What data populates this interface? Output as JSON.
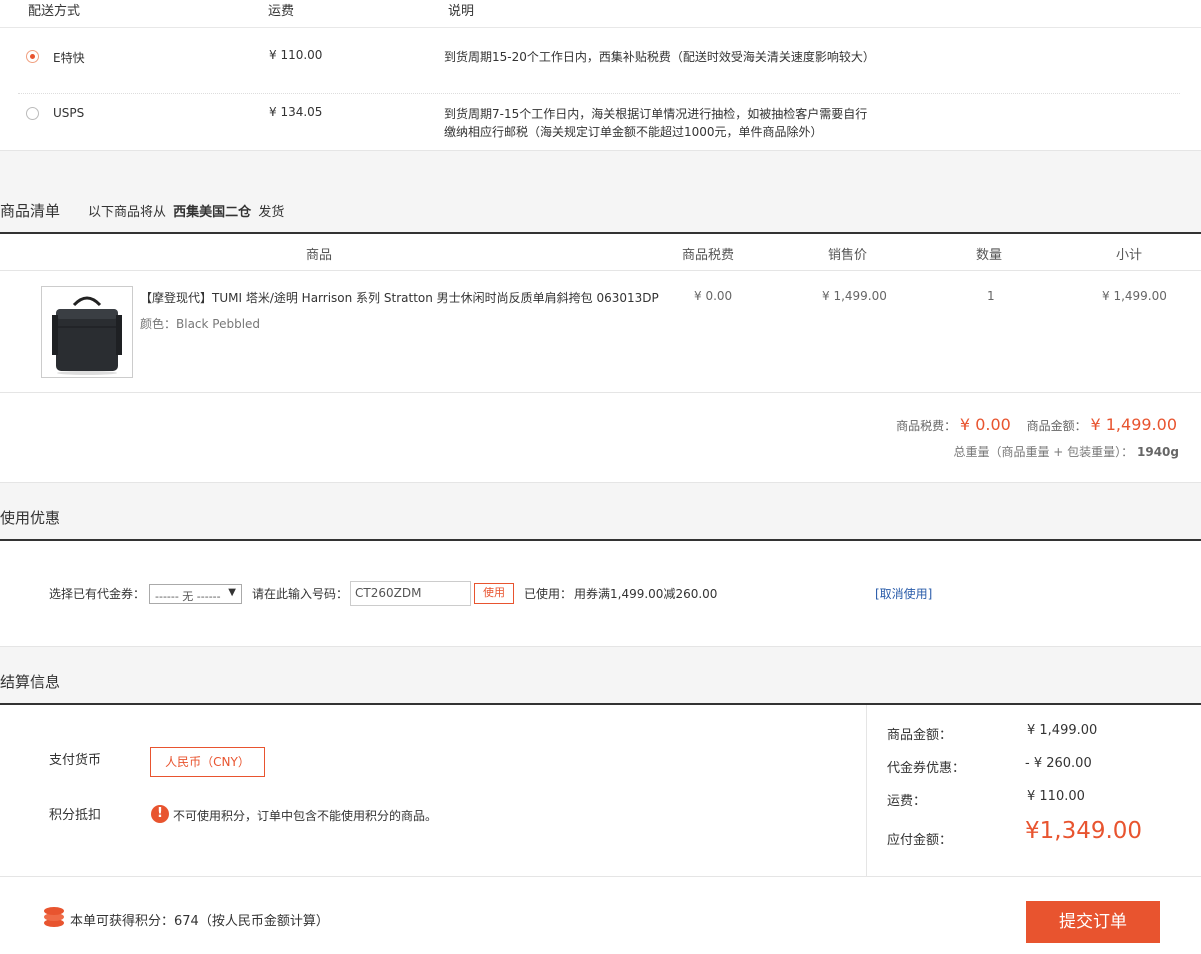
{
  "shipping": {
    "headers": [
      "配送方式",
      "运费",
      "说明"
    ],
    "options": [
      {
        "name": "E特快",
        "fee": "¥ 110.00",
        "desc": [
          "到货周期15-20个工作日内，西集补贴税费（配送时效受海关清关速度影响较大）"
        ],
        "selected": true
      },
      {
        "name": "USPS",
        "fee": "¥ 134.05",
        "desc": [
          "到货周期7-15个工作日内，海关根据订单情况进行抽检，如被抽检客户需要自行",
          "缴纳相应行邮税（海关规定订单金额不能超过1000元，单件商品除外）"
        ],
        "selected": false
      }
    ]
  },
  "goods": {
    "title": "商品清单",
    "ship_from_prefix": "以下商品将从",
    "warehouse": "西集美国二仓",
    "ship_from_suffix": "发货",
    "columns": [
      "商品",
      "商品税费",
      "销售价",
      "数量",
      "小计"
    ],
    "items": [
      {
        "name": "【摩登现代】TUMI 塔米/途明 Harrison 系列 Stratton 男士休闲时尚反质单肩斜挎包 063013DP",
        "color": "颜色：Black Pebbled",
        "tax": "¥ 0.00",
        "price": "¥ 1,499.00",
        "qty": "1",
        "subtotal": "¥ 1,499.00"
      }
    ],
    "summary": {
      "tax_label": "商品税费：",
      "tax_value": "¥ 0.00",
      "amount_label": "商品金额：",
      "amount_value": "¥ 1,499.00",
      "weight_label": "总重量（商品重量 + 包装重量）：",
      "weight_value": "1940g"
    }
  },
  "coupon": {
    "title": "使用优惠",
    "select_label": "选择已有代金券：",
    "select_value": "------ 无 ------",
    "input_label": "请在此输入号码：",
    "input_value": "CT260ZDM",
    "use_button": "使用",
    "used_label": "已使用：",
    "used_value": "用券满1,499.00减260.00",
    "cancel_link": "[取消使用]"
  },
  "settlement": {
    "title": "结算信息",
    "currency_label": "支付货币",
    "currency_value": "人民币（CNY）",
    "points_label": "积分抵扣",
    "points_notice": "不可使用积分，订单中包含不能使用积分的商品。",
    "summary": [
      {
        "label": "商品金额：",
        "value": "¥ 1,499.00"
      },
      {
        "label": "代金券优惠：",
        "value": "- ¥ 260.00"
      },
      {
        "label": "运费：",
        "value": "¥ 110.00"
      }
    ],
    "payable_label": "应付金额：",
    "payable_value": "¥1,349.00"
  },
  "footer": {
    "points_earned": "本单可获得积分：674（按人民币金额计算）",
    "submit_label": "提交订单"
  },
  "colors": {
    "accent": "#e8542f"
  }
}
